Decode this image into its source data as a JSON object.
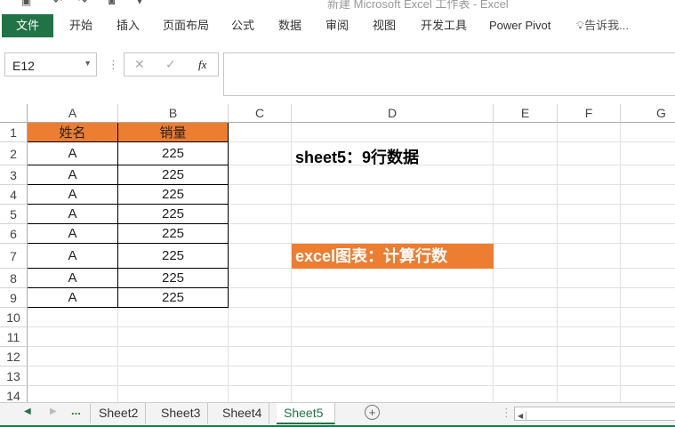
{
  "window": {
    "title": "新建 Microsoft Excel 工作表 - Excel"
  },
  "ribbon": {
    "tabs": [
      "文件",
      "开始",
      "插入",
      "页面布局",
      "公式",
      "数据",
      "审阅",
      "视图",
      "开发工具",
      "Power Pivot"
    ],
    "tell_me": "告诉我..."
  },
  "formula_bar": {
    "name_box": "E12",
    "cancel": "✕",
    "enter": "✓",
    "fx": "fx",
    "value": ""
  },
  "columns": [
    "A",
    "B",
    "C",
    "D",
    "E",
    "F",
    "G"
  ],
  "rows": [
    "1",
    "2",
    "3",
    "4",
    "5",
    "6",
    "7",
    "8",
    "9",
    "10",
    "11",
    "12",
    "13",
    "14"
  ],
  "table": {
    "headers": [
      "姓名",
      "销量"
    ],
    "rows": [
      [
        "A",
        "225"
      ],
      [
        "A",
        "225"
      ],
      [
        "A",
        "225"
      ],
      [
        "A",
        "225"
      ],
      [
        "A",
        "225"
      ],
      [
        "A",
        "225"
      ],
      [
        "A",
        "225"
      ],
      [
        "A",
        "225"
      ]
    ]
  },
  "notes": {
    "sheet_info": "sheet5：9行数据",
    "banner": "excel图表：计算行数"
  },
  "sheet_tabs": {
    "ellipsis": "...",
    "tabs": [
      "Sheet2",
      "Sheet3",
      "Sheet4",
      "Sheet5"
    ],
    "active": "Sheet5"
  },
  "colors": {
    "accent": "#217346",
    "header_fill": "#ed7d31"
  }
}
